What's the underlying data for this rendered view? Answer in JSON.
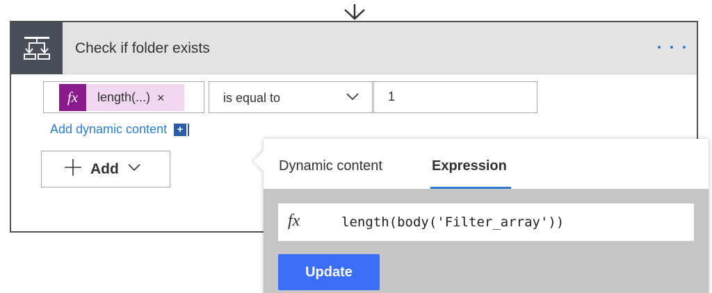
{
  "connector": {
    "icon": "flow-down-arrow-icon"
  },
  "action_card": {
    "title": "Check if folder exists",
    "icon": "condition-icon",
    "menu_icon": "more-options-icon",
    "header_color": "#e3e3e3",
    "icon_box_color": "#484f58"
  },
  "condition": {
    "left_token": {
      "icon": "fx",
      "label": "length(...)",
      "remove": "×",
      "token_color": "#8b1a8d"
    },
    "operator": {
      "selected": "is equal to"
    },
    "right_value": "1"
  },
  "add_dynamic_content": {
    "label": "Add dynamic content",
    "plus": "+"
  },
  "add_menu": {
    "label": "Add"
  },
  "popover": {
    "tabs": [
      {
        "label": "Dynamic content",
        "active": false
      },
      {
        "label": "Expression",
        "active": true
      }
    ],
    "expression": {
      "icon": "fx",
      "value": "length(body('Filter_array'))"
    },
    "update_label": "Update",
    "accent_color": "#2b7cd3",
    "button_color": "#3b6ef5"
  }
}
